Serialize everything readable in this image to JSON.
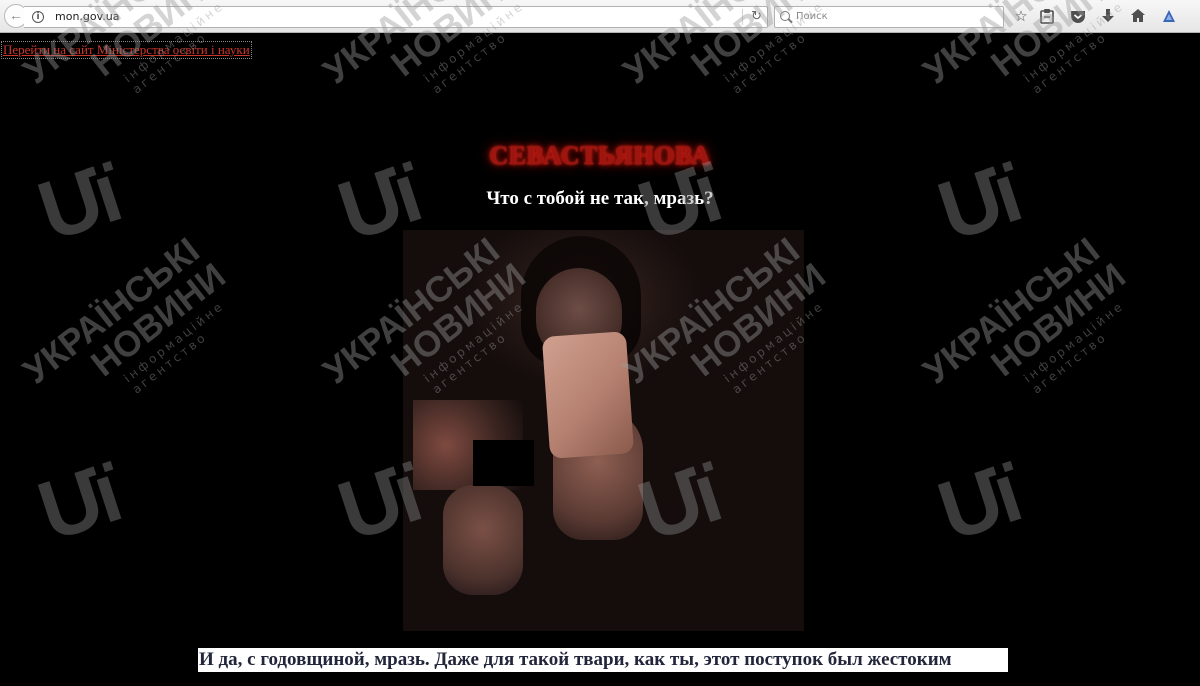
{
  "browser": {
    "url": "mon.gov.ua",
    "search_placeholder": "Поиск",
    "icons": {
      "back": "back-arrow-icon",
      "site_info": "info-icon",
      "reload": "reload-icon",
      "search": "search-icon",
      "bookmark": "star-icon",
      "reading_list": "clipboard-icon",
      "pocket": "pocket-icon",
      "downloads": "download-arrow-icon",
      "home": "home-icon",
      "extension": "triangle-extension-icon"
    }
  },
  "page": {
    "ministry_link": "Перейти на сайт Міністерства освіти і науки",
    "hacker_name": "СЕВАСТЬЯНОВА",
    "heading": "Что с тобой не так, мразь?",
    "anniversary_text": "И да, с годовщиной, мразь. Даже для такой твари, как ты, этот поступок был жестоким"
  },
  "watermark": {
    "logo": "UN",
    "line1": "УКРАЇНСЬКІ",
    "line2": "НОВИНИ",
    "line3": "інформаційне агентство"
  },
  "colors": {
    "page_background": "#000000",
    "link": "#c9372c",
    "hacker_name": "#9c1510",
    "heading": "#ffffff",
    "anniversary_text": "#22263a"
  }
}
